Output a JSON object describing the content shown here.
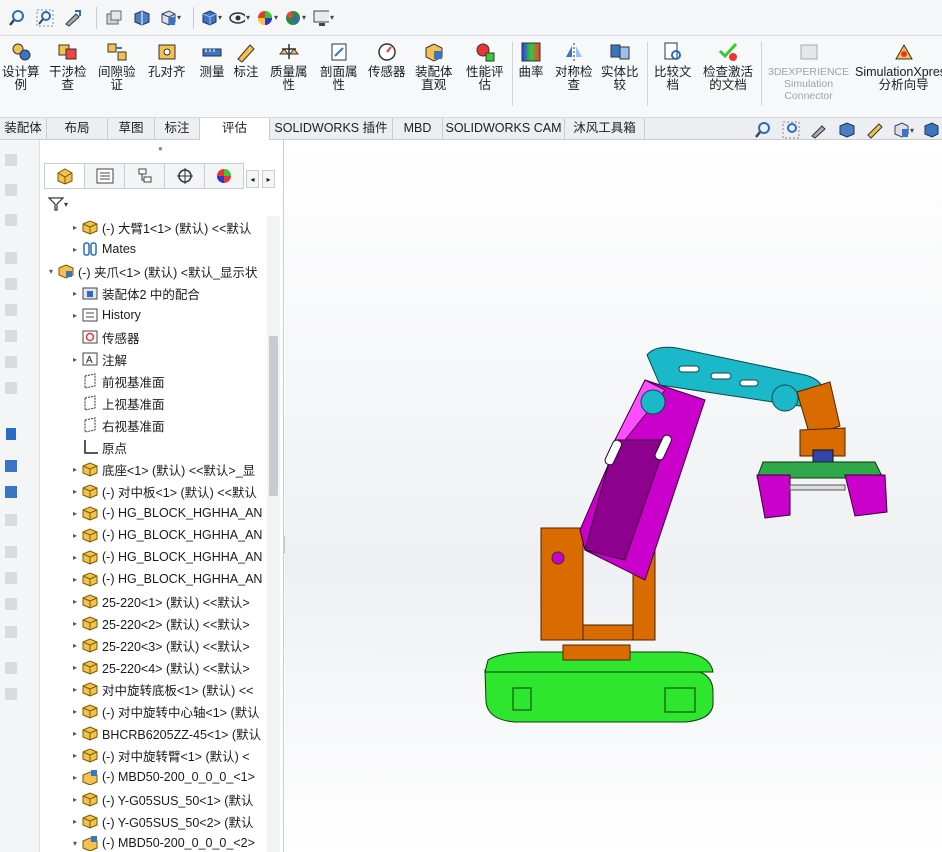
{
  "quick_access": {
    "icons": [
      "zoom-icon",
      "zoom-area-icon",
      "rotate-icon",
      "display-style-icon",
      "section-view-icon",
      "view-orientation-icon",
      "display-mode-icon",
      "hide-show-icon",
      "appearance-icon",
      "scene-icon",
      "monitor-icon"
    ]
  },
  "ribbon": {
    "buttons": [
      {
        "label": "设计算\n例",
        "icon": "design-study-icon"
      },
      {
        "label": "干涉检\n查",
        "icon": "interference-check-icon"
      },
      {
        "label": "间隙验\n证",
        "icon": "clearance-verification-icon"
      },
      {
        "label": "孔对齐",
        "icon": "hole-alignment-icon"
      },
      {
        "label": "测量",
        "icon": "measure-icon"
      },
      {
        "label": "标注",
        "icon": "markup-icon"
      },
      {
        "label": "质量属\n性",
        "icon": "mass-properties-icon"
      },
      {
        "label": "剖面属\n性",
        "icon": "section-properties-icon"
      },
      {
        "label": "传感器",
        "icon": "sensor-icon"
      },
      {
        "label": "装配体\n直观",
        "icon": "assemblyxpert-icon"
      },
      {
        "label": "性能评\n估",
        "icon": "performance-evaluation-icon"
      },
      {
        "label": "曲率",
        "icon": "curvature-icon"
      },
      {
        "label": "对称检\n查",
        "icon": "symmetry-check-icon"
      },
      {
        "label": "实体比\n较",
        "icon": "compare-bodies-icon"
      },
      {
        "label": "比较文\n档",
        "icon": "compare-documents-icon"
      },
      {
        "label": "检查激活\n的文档",
        "icon": "check-active-document-icon"
      },
      {
        "label": "3DEXPERIENCE\nSimulation\nConnector",
        "icon": "3dexperience-icon",
        "disabled": true
      },
      {
        "label": "SimulationXpress\n分析向导",
        "icon": "simulationxpress-icon"
      }
    ]
  },
  "tabs": [
    "装配体",
    "布局",
    "草图",
    "标注",
    "评估",
    "SOLIDWORKS 插件",
    "MBD",
    "SOLIDWORKS CAM",
    "沐风工具箱"
  ],
  "active_tab": "评估",
  "feature_tree": {
    "rows": [
      {
        "label": "(-) 大臂1<1> (默认) <<默认",
        "icon": "part",
        "exp": "▸",
        "indent": 1
      },
      {
        "label": "Mates",
        "icon": "mates",
        "exp": "▸",
        "indent": 1
      },
      {
        "label": "(-) 夹爪<1> (默认) <默认_显示状",
        "icon": "assembly",
        "exp": "▾",
        "indent": 0
      },
      {
        "label": "装配体2 中的配合",
        "icon": "mates-folder",
        "exp": "▸",
        "indent": 1
      },
      {
        "label": "History",
        "icon": "history",
        "exp": "▸",
        "indent": 1
      },
      {
        "label": "传感器",
        "icon": "sensor",
        "exp": "",
        "indent": 1
      },
      {
        "label": "注解",
        "icon": "annotation",
        "exp": "▸",
        "indent": 1
      },
      {
        "label": "前视基准面",
        "icon": "plane",
        "exp": "",
        "indent": 1
      },
      {
        "label": "上视基准面",
        "icon": "plane",
        "exp": "",
        "indent": 1
      },
      {
        "label": "右视基准面",
        "icon": "plane",
        "exp": "",
        "indent": 1
      },
      {
        "label": "原点",
        "icon": "origin",
        "exp": "",
        "indent": 1
      },
      {
        "label": "底座<1> (默认) <<默认>_显",
        "icon": "part",
        "exp": "▸",
        "indent": 1
      },
      {
        "label": "(-) 对中板<1> (默认) <<默认",
        "icon": "part",
        "exp": "▸",
        "indent": 1
      },
      {
        "label": "(-) HG_BLOCK_HGHHA_AN",
        "icon": "part",
        "exp": "▸",
        "indent": 1
      },
      {
        "label": "(-) HG_BLOCK_HGHHA_AN",
        "icon": "part",
        "exp": "▸",
        "indent": 1
      },
      {
        "label": "(-) HG_BLOCK_HGHHA_AN",
        "icon": "part",
        "exp": "▸",
        "indent": 1
      },
      {
        "label": "(-) HG_BLOCK_HGHHA_AN",
        "icon": "part",
        "exp": "▸",
        "indent": 1
      },
      {
        "label": "25-220<1> (默认) <<默认>",
        "icon": "part",
        "exp": "▸",
        "indent": 1
      },
      {
        "label": "25-220<2> (默认) <<默认>",
        "icon": "part",
        "exp": "▸",
        "indent": 1
      },
      {
        "label": "25-220<3> (默认) <<默认>",
        "icon": "part",
        "exp": "▸",
        "indent": 1
      },
      {
        "label": "25-220<4> (默认) <<默认>",
        "icon": "part",
        "exp": "▸",
        "indent": 1
      },
      {
        "label": "对中旋转底板<1> (默认) <<",
        "icon": "part",
        "exp": "▸",
        "indent": 1
      },
      {
        "label": "(-) 对中旋转中心轴<1> (默认",
        "icon": "part",
        "exp": "▸",
        "indent": 1
      },
      {
        "label": "BHCRB6205ZZ-45<1> (默认",
        "icon": "part",
        "exp": "▸",
        "indent": 1
      },
      {
        "label": "(-) 对中旋转臂<1> (默认) <",
        "icon": "part",
        "exp": "▸",
        "indent": 1
      },
      {
        "label": "(-) MBD50-200_0_0_0_<1>",
        "icon": "subassembly",
        "exp": "▸",
        "indent": 1
      },
      {
        "label": "(-) Y-G05SUS_50<1> (默认",
        "icon": "part",
        "exp": "▸",
        "indent": 1
      },
      {
        "label": "(-) Y-G05SUS_50<2> (默认",
        "icon": "part",
        "exp": "▸",
        "indent": 1
      },
      {
        "label": "(-) MBD50-200_0_0_0_<2>",
        "icon": "subassembly",
        "exp": "▾",
        "indent": 1
      }
    ]
  },
  "colors": {
    "base": "#2ee62e",
    "column": "#d96b00",
    "arm": "#cc00cc",
    "forearm": "#1ab8c8",
    "gripper": "#cc00cc",
    "gripper_plate": "#2fa84a",
    "accent": "#1f5fbf"
  }
}
